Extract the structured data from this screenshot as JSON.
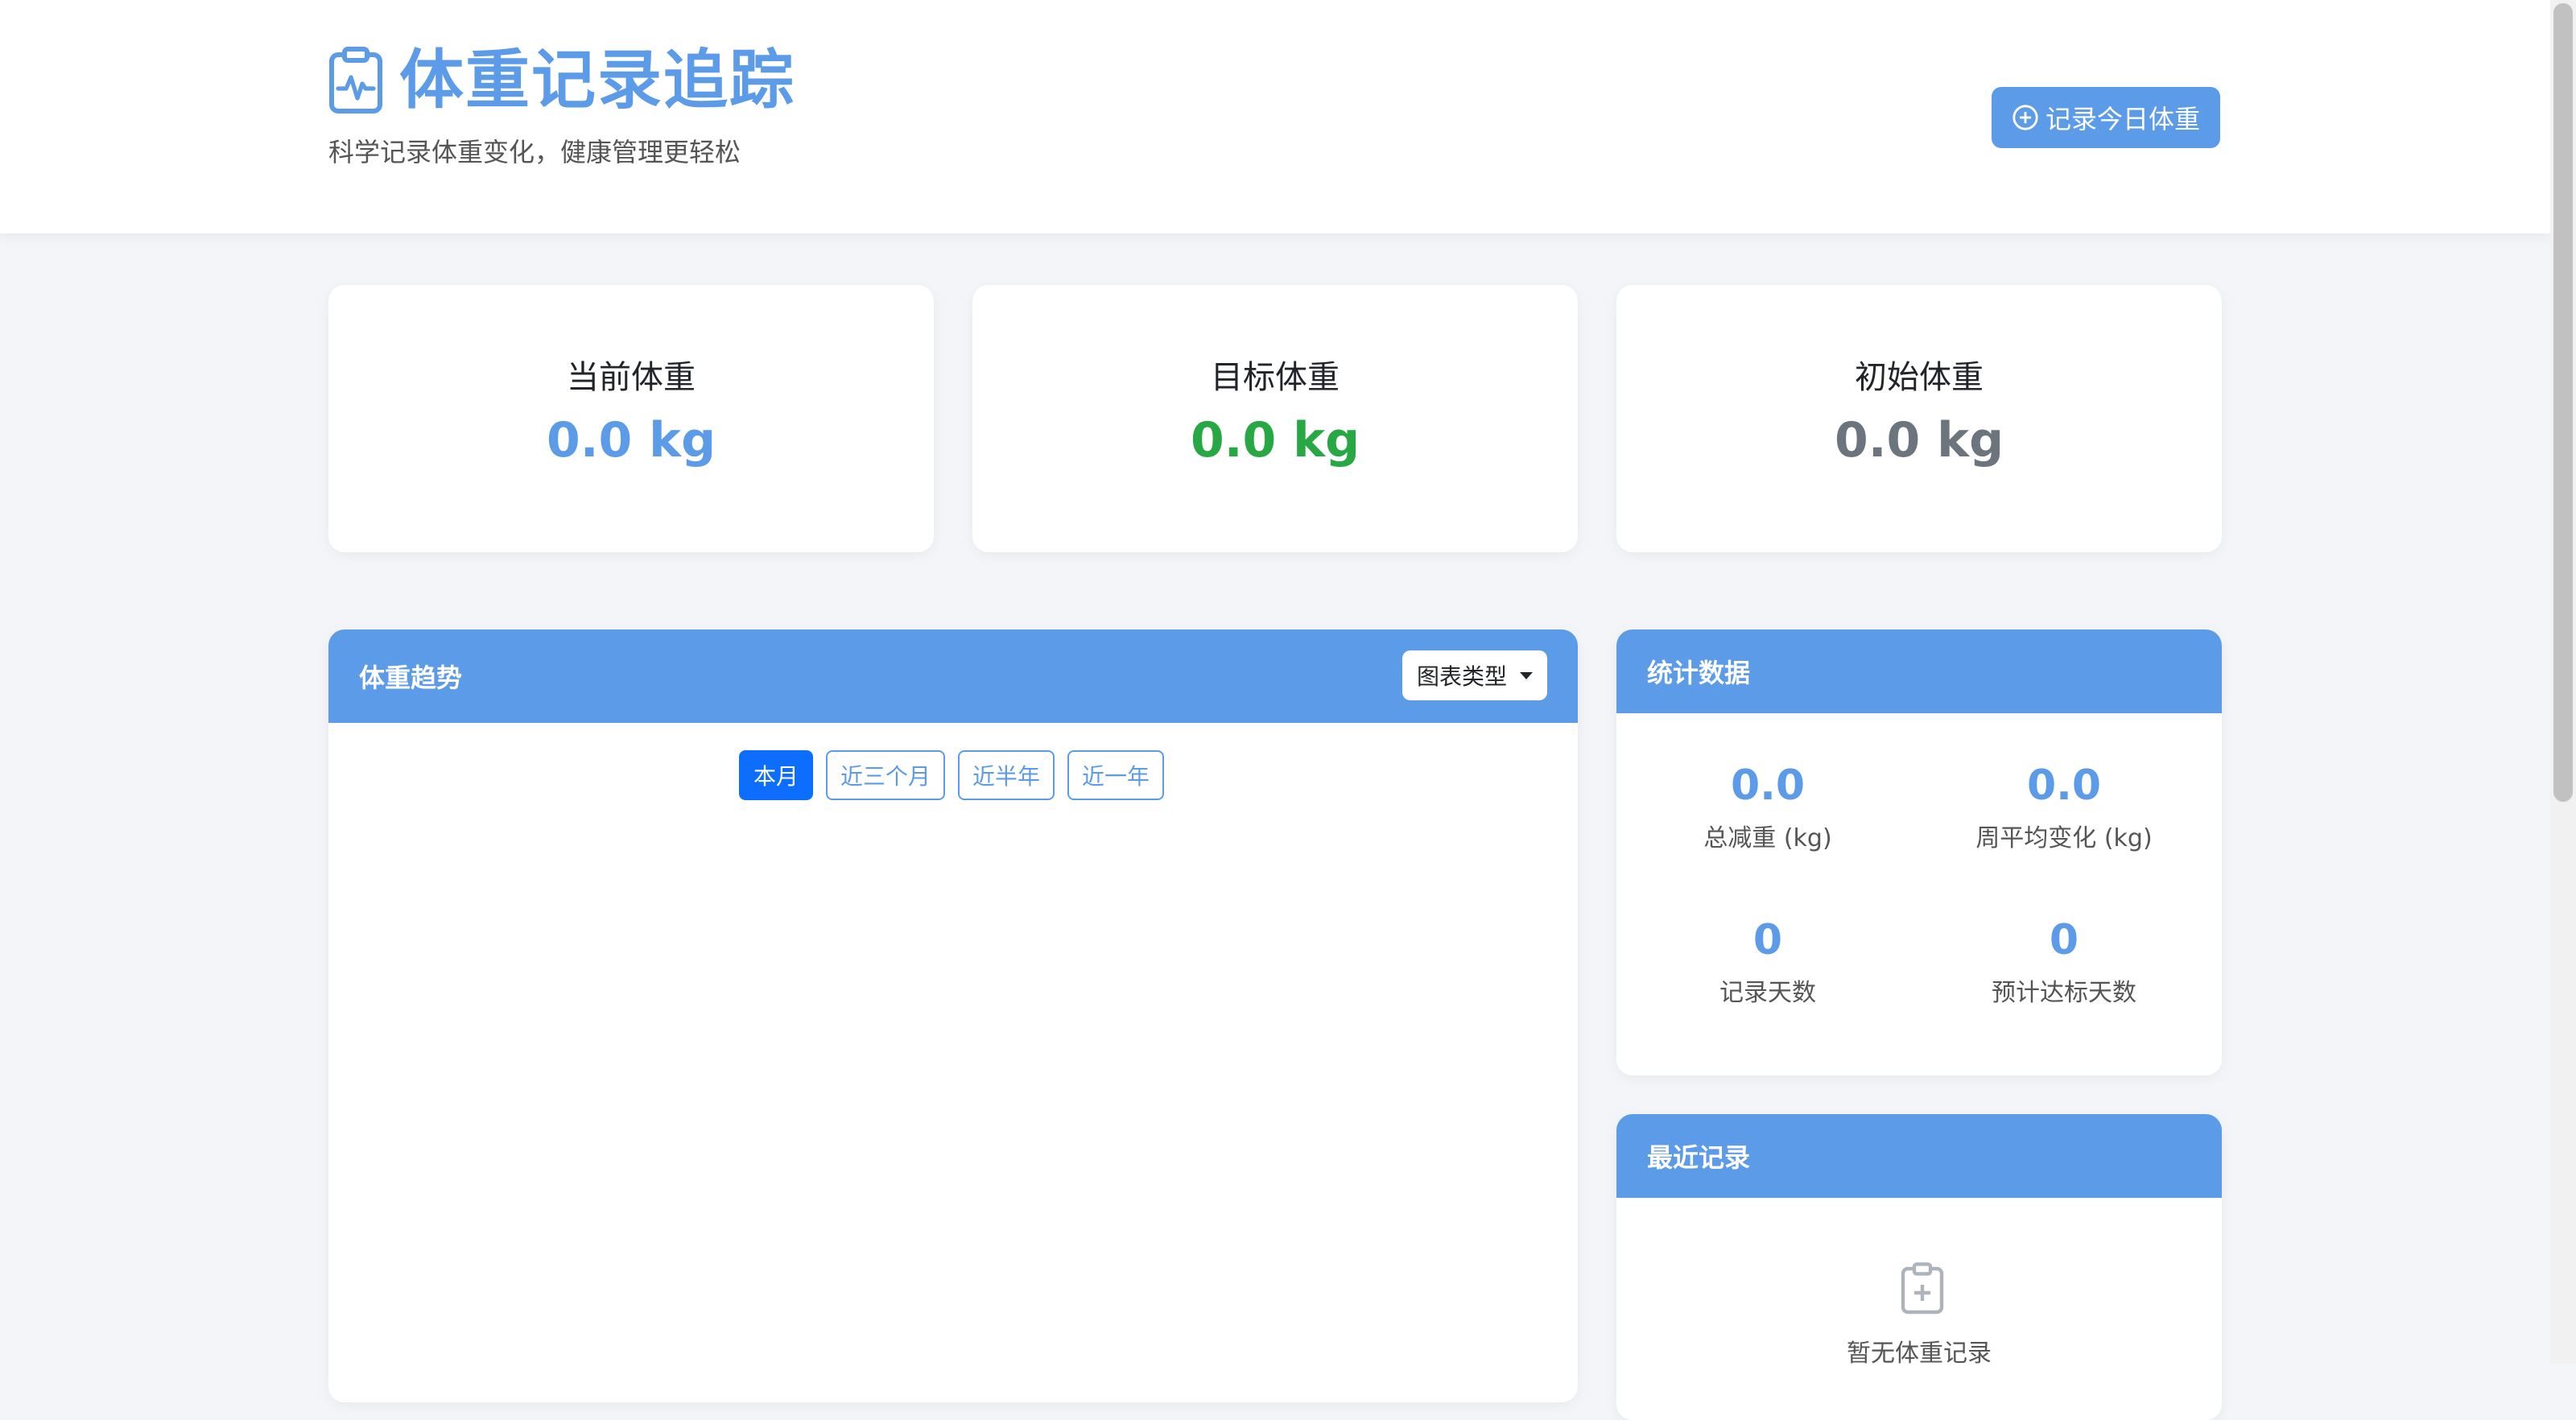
{
  "header": {
    "title": "体重记录追踪",
    "subtitle": "科学记录体重变化，健康管理更轻松",
    "record_button": "记录今日体重"
  },
  "summary_cards": [
    {
      "label": "当前体重",
      "value": "0.0 kg",
      "color": "#5c9be8"
    },
    {
      "label": "目标体重",
      "value": "0.0 kg",
      "color": "#28a745"
    },
    {
      "label": "初始体重",
      "value": "0.0 kg",
      "color": "#6c757d"
    }
  ],
  "trend_panel": {
    "title": "体重趋势",
    "chart_type_label": "图表类型",
    "ranges": [
      "本月",
      "近三个月",
      "近半年",
      "近一年"
    ],
    "active_range_index": 0
  },
  "stats_panel": {
    "title": "统计数据",
    "items": [
      {
        "value": "0.0",
        "caption": "总减重 (kg)"
      },
      {
        "value": "0.0",
        "caption": "周平均变化 (kg)"
      },
      {
        "value": "0",
        "caption": "记录天数"
      },
      {
        "value": "0",
        "caption": "预计达标天数"
      }
    ]
  },
  "recent_panel": {
    "title": "最近记录",
    "empty_text": "暂无体重记录"
  },
  "colors": {
    "accent": "#5c9be8",
    "active": "#0d6efd",
    "green": "#28a745",
    "gray": "#6c757d"
  },
  "icons": {
    "brand": "clipboard-pulse-icon",
    "record_button": "plus-circle-icon",
    "empty": "clipboard-plus-icon",
    "chart_type_caret": "caret-down-icon"
  }
}
